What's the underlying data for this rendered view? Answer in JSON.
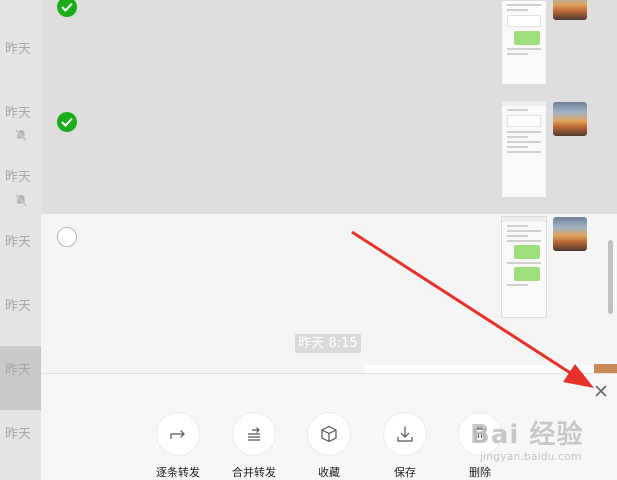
{
  "sidebar": {
    "items": [
      {
        "date": "昨天",
        "muted": false
      },
      {
        "date": "昨天",
        "muted": true
      },
      {
        "date": "昨天",
        "muted": true
      },
      {
        "date": "昨天",
        "muted": false
      },
      {
        "date": "昨天",
        "muted": false
      },
      {
        "date": "昨天",
        "muted": false,
        "active": true
      },
      {
        "date": "昨天",
        "muted": false
      }
    ]
  },
  "chat": {
    "messages": [
      {
        "selected": true
      },
      {
        "selected": true
      },
      {
        "selected": false
      }
    ],
    "time_divider": "昨天 8:15"
  },
  "actions": {
    "items": [
      {
        "label": "逐条转发",
        "icon": "share-icon"
      },
      {
        "label": "合并转发",
        "icon": "merge-forward-icon"
      },
      {
        "label": "收藏",
        "icon": "favorite-cube-icon"
      },
      {
        "label": "保存",
        "icon": "download-icon"
      },
      {
        "label": "删除",
        "icon": "trash-icon"
      }
    ],
    "close_icon": "close-icon"
  },
  "colors": {
    "accent_green": "#1aad19",
    "annotation_arrow": "#e8312a"
  },
  "watermark": {
    "text": "Bai 经验",
    "url": "jingyan.baidu.com"
  }
}
